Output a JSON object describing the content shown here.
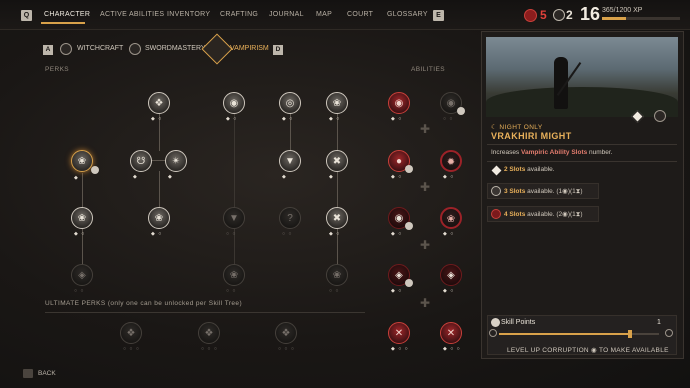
{
  "nav": {
    "left_key": "Q",
    "right_key": "E",
    "tabs": [
      "CHARACTER",
      "ACTIVE ABILITIES",
      "INVENTORY",
      "CRAFTING",
      "JOURNAL",
      "MAP",
      "COURT",
      "GLOSSARY"
    ],
    "active_tab": "CHARACTER"
  },
  "stats": {
    "health": "5",
    "devotion": "2",
    "level": "16",
    "xp_text": "365/1200 XP",
    "xp_progress": 0.304
  },
  "skill_trees": {
    "left_key": "A",
    "right_key": "D",
    "tabs": [
      "WITCHCRAFT",
      "SWORDMASTERY",
      "VAMPIRISM"
    ],
    "active": "VAMPIRISM"
  },
  "labels": {
    "perks": "PERKS",
    "abilities": "ABILITIES",
    "ultimate_perks": "ULTIMATE PERKS (only one can be unlocked per Skill Tree)"
  },
  "detail": {
    "tag": "☾ NIGHT ONLY",
    "title": "VRAKHIRI MIGHT",
    "desc_prefix": "Increases ",
    "desc_highlight": "Vampiric Ability Slots",
    "desc_suffix": " number.",
    "slots": [
      {
        "count": "2 Slots",
        "rest": " available."
      },
      {
        "count": "3 Slots",
        "rest": " available.  (1◉)(1⧗)"
      },
      {
        "count": "4 Slots",
        "rest": " available.  (2◉)(1⧗)"
      }
    ]
  },
  "skill_points": {
    "label": "Skill Points",
    "count": "1",
    "hint": "LEVEL UP CORRUPTION ◉ TO MAKE AVAILABLE",
    "progress": 0.82
  },
  "footer": {
    "back_key": "Esc",
    "back": "BACK"
  },
  "colors": {
    "accent": "#d8a14a",
    "blood": "#c9403a",
    "bg": "#1a1715"
  }
}
